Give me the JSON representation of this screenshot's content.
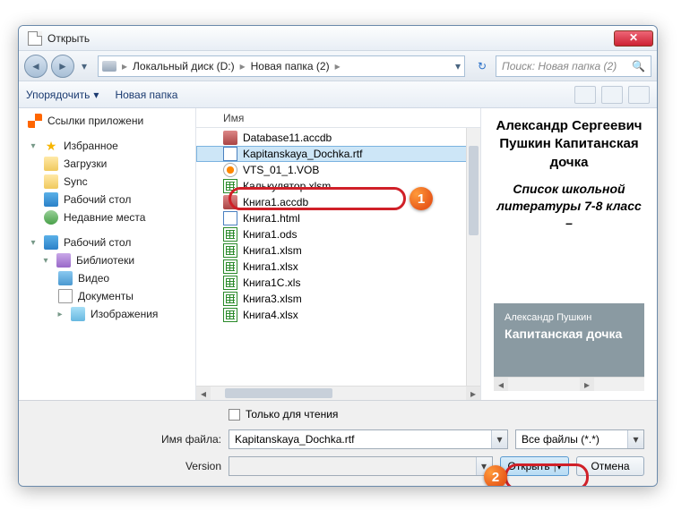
{
  "window": {
    "title": "Открыть"
  },
  "nav": {
    "breadcrumbs": [
      "Локальный диск (D:)",
      "Новая папка (2)"
    ],
    "search_placeholder": "Поиск: Новая папка (2)"
  },
  "toolbar": {
    "organize": "Упорядочить",
    "new_folder": "Новая папка"
  },
  "sidebar": {
    "app_links_head": "Ссылки приложени",
    "favorites_head": "Избранное",
    "favorites": [
      "Загрузки",
      "Sync",
      "Рабочий стол",
      "Недавние места"
    ],
    "desktop_head": "Рабочий стол",
    "libraries_head": "Библиотеки",
    "libraries": [
      "Видео",
      "Документы",
      "Изображения"
    ]
  },
  "filelist": {
    "col_name": "Имя",
    "files": [
      {
        "name": "Database11.accdb",
        "type": "accdb"
      },
      {
        "name": "Kapitanskaya_Dochka.rtf",
        "type": "rtf",
        "selected": true
      },
      {
        "name": "VTS_01_1.VOB",
        "type": "vob"
      },
      {
        "name": "Калькулятор.xlsm",
        "type": "xls"
      },
      {
        "name": "Книга1.accdb",
        "type": "accdb"
      },
      {
        "name": "Книга1.html",
        "type": "html"
      },
      {
        "name": "Книга1.ods",
        "type": "xls"
      },
      {
        "name": "Книга1.xlsm",
        "type": "xls"
      },
      {
        "name": "Книга1.xlsx",
        "type": "xls"
      },
      {
        "name": "Книга1C.xls",
        "type": "xls"
      },
      {
        "name": "Книга3.xlsm",
        "type": "xls"
      },
      {
        "name": "Книга4.xlsx",
        "type": "xls"
      }
    ]
  },
  "preview": {
    "title": "Александр Сергеевич Пушкин Капитанская дочка",
    "subtitle": "Список школьной литературы 7-8 класс –",
    "card_author": "Александр Пушкин",
    "card_title": "Капитанская дочка"
  },
  "footer": {
    "readonly_label": "Только для чтения",
    "filename_label": "Имя файла:",
    "filename_value": "Kapitanskaya_Dochka.rtf",
    "filetype_value": "Все файлы (*.*)",
    "version_label": "Version",
    "open_btn": "Открыть",
    "cancel_btn": "Отмена"
  },
  "badges": {
    "b1": "1",
    "b2": "2"
  }
}
